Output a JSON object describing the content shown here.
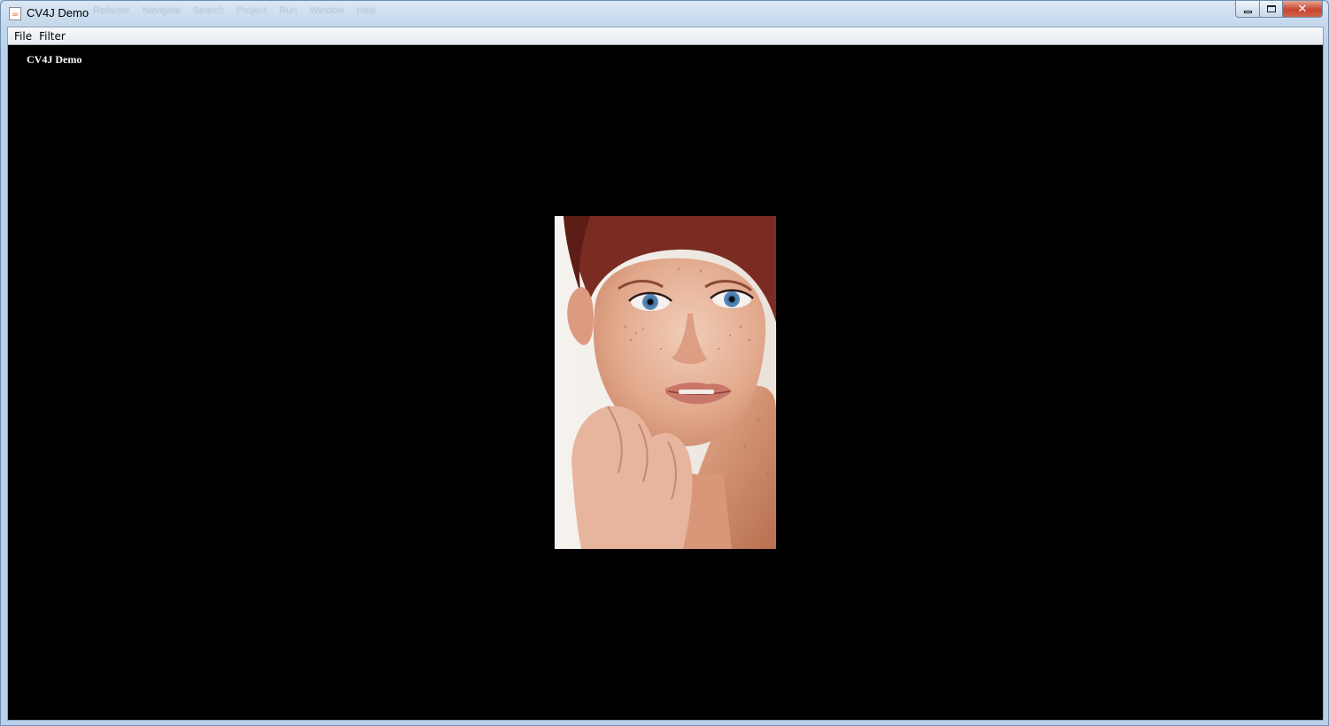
{
  "window": {
    "title": "CV4J Demo",
    "background_menu_ghost": [
      "Refactor",
      "Navigate",
      "Search",
      "Project",
      "Run",
      "Window",
      "Help"
    ]
  },
  "menubar": {
    "items": [
      {
        "label": "File"
      },
      {
        "label": "Filter"
      }
    ]
  },
  "canvas": {
    "label": "CV4J Demo",
    "background_color": "#000000",
    "image": {
      "description_icon": "portrait-photo"
    }
  },
  "colors": {
    "titlebar": "#c4d7ec",
    "close_button": "#c7452d",
    "canvas": "#000000"
  }
}
